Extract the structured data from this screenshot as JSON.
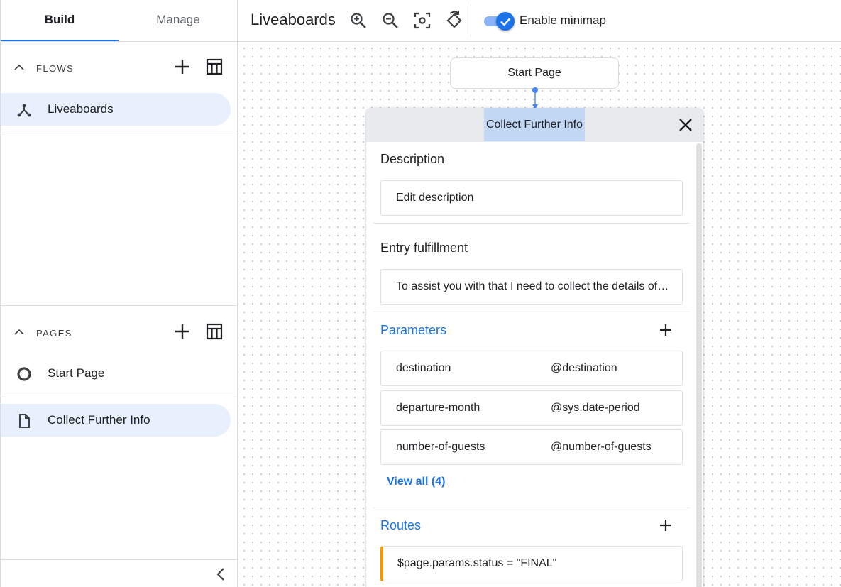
{
  "tabs": {
    "build": "Build",
    "manage": "Manage"
  },
  "flows": {
    "title": "FLOWS",
    "items": [
      {
        "label": "Liveaboards",
        "icon": "flow-icon"
      }
    ]
  },
  "pages": {
    "title": "PAGES",
    "items": [
      {
        "label": "Start Page",
        "icon": "circle-icon"
      },
      {
        "label": "Collect Further Info",
        "icon": "page-icon"
      }
    ]
  },
  "toolbar": {
    "title": "Liveaboards",
    "minimap_label": "Enable minimap",
    "minimap_enabled": true,
    "icons": [
      "zoom-in-icon",
      "zoom-out-icon",
      "fit-screen-icon",
      "reset-rotate-icon"
    ]
  },
  "canvas": {
    "start_node": "Start Page",
    "panel": {
      "title": "Collect Further Info",
      "description": {
        "heading": "Description",
        "placeholder": "Edit description"
      },
      "entry_fulfillment": {
        "heading": "Entry fulfillment",
        "text": "To assist you with that I need to collect the details of your trip."
      },
      "parameters": {
        "heading": "Parameters",
        "rows": [
          {
            "name": "destination",
            "type": "@destination"
          },
          {
            "name": "departure-month",
            "type": "@sys.date-period"
          },
          {
            "name": "number-of-guests",
            "type": "@number-of-guests"
          }
        ],
        "view_all": "View all (4)"
      },
      "routes": {
        "heading": "Routes",
        "items": [
          {
            "condition": "$page.params.status = \"FINAL\""
          }
        ]
      }
    }
  },
  "colors": {
    "accent": "#1a73e8",
    "selected_bg": "#e8f0fe",
    "route_marker": "#f29900"
  }
}
